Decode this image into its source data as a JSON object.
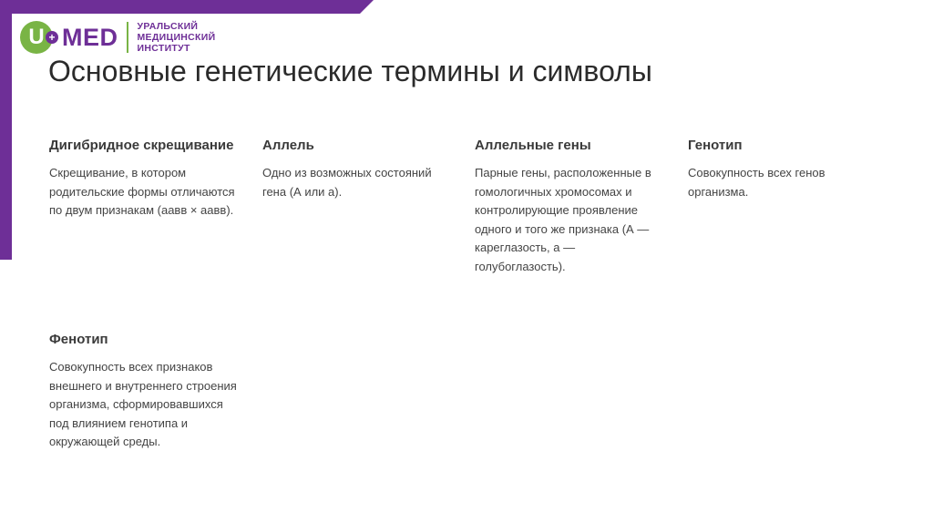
{
  "brand": {
    "logo_letter": "U",
    "logo_plus": "+",
    "logo_text": "MED",
    "caption_lines": [
      "УРАЛЬСКИЙ",
      "МЕДИЦИНСКИЙ",
      "ИНСТИТУТ"
    ],
    "colors": {
      "purple": "#6e2f97",
      "green": "#79b445"
    }
  },
  "title": "Основные генетические термины и символы",
  "terms": [
    {
      "name": "Дигибридное скрещивание",
      "description": "Скрещивание, в котором родительские формы отличаются по двум признакам (аавв × аавв)."
    },
    {
      "name": "Аллель",
      "description": "Одно из возможных состояний гена (А или а)."
    },
    {
      "name": "Аллельные гены",
      "description": "Парные гены, расположенные в гомологичных хромосомах и контролирующие проявление одного и того же признака (А — кареглазость, а — голубоглазость)."
    },
    {
      "name": "Генотип",
      "description": "Совокупность всех генов организма."
    },
    {
      "name": "Фенотип",
      "description": "Совокупность всех признаков внешнего и внутреннего строения организма, сформировавшихся под влиянием генотипа и окружающей среды."
    }
  ]
}
